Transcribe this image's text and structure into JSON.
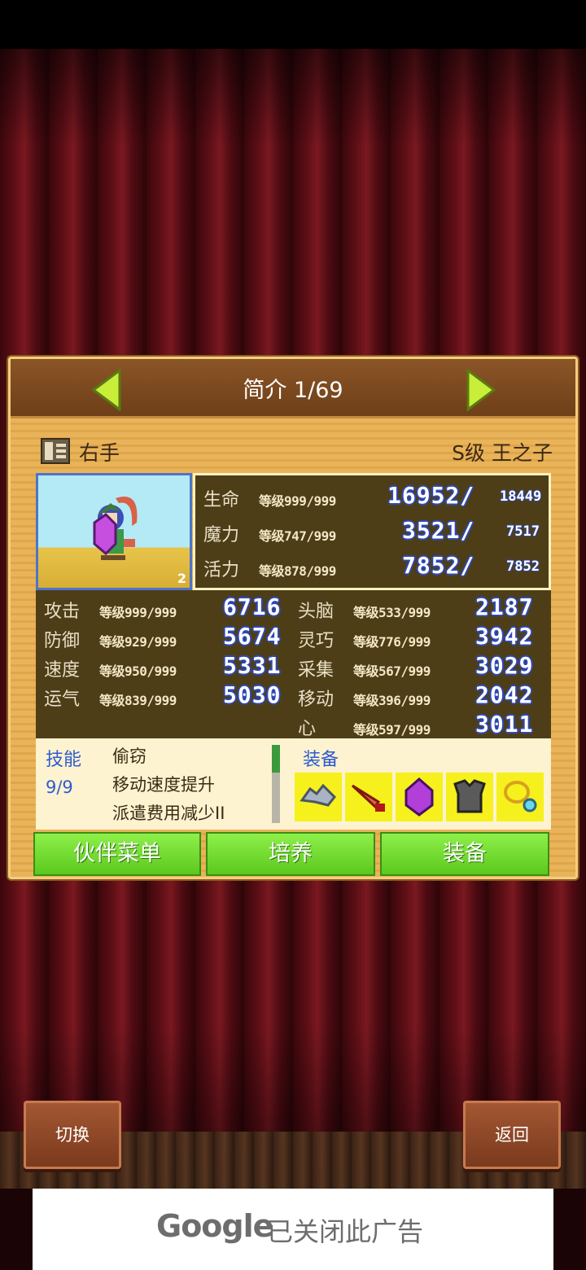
{
  "header": {
    "title": "简介 1/69"
  },
  "character": {
    "role": "右手",
    "rank": "S级 王之子",
    "level_badge": "2"
  },
  "vitals": [
    {
      "label": "生命",
      "level": "等级999/999",
      "current": "16952/",
      "max": "18449"
    },
    {
      "label": "魔力",
      "level": "等级747/999",
      "current": "3521/",
      "max": "7517"
    },
    {
      "label": "活力",
      "level": "等级878/999",
      "current": "7852/",
      "max": "7852"
    }
  ],
  "stats_left": [
    {
      "label": "攻击",
      "level": "等级999/999",
      "value": "6716"
    },
    {
      "label": "防御",
      "level": "等级929/999",
      "value": "5674"
    },
    {
      "label": "速度",
      "level": "等级950/999",
      "value": "5331"
    },
    {
      "label": "运气",
      "level": "等级839/999",
      "value": "5030"
    }
  ],
  "stats_right": [
    {
      "label": "头脑",
      "level": "等级533/999",
      "value": "2187"
    },
    {
      "label": "灵巧",
      "level": "等级776/999",
      "value": "3942"
    },
    {
      "label": "采集",
      "level": "等级567/999",
      "value": "3029"
    },
    {
      "label": "移动",
      "level": "等级396/999",
      "value": "2042"
    },
    {
      "label": "心",
      "level": "等级597/999",
      "value": "3011"
    }
  ],
  "skills": {
    "title": "技能",
    "count": "9/9",
    "items": [
      "偷窃",
      "移动速度提升",
      "派遣费用减少II"
    ]
  },
  "equipment": {
    "title": "装备",
    "items": [
      "gauntlet-icon",
      "sword-icon",
      "gem-icon",
      "armor-icon",
      "necklace-icon"
    ]
  },
  "buttons": {
    "companion_menu": "伙伴菜单",
    "train": "培养",
    "equip": "装备"
  },
  "corner": {
    "switch": "切换",
    "back": "返回"
  },
  "ad": {
    "brand": "Google",
    "text": "已关闭此广告"
  },
  "colors": {
    "accent_green": "#6fd62e",
    "value_outline": "#2d49b8",
    "panel": "#e4a449",
    "stat_bg": "#4e3e17"
  }
}
